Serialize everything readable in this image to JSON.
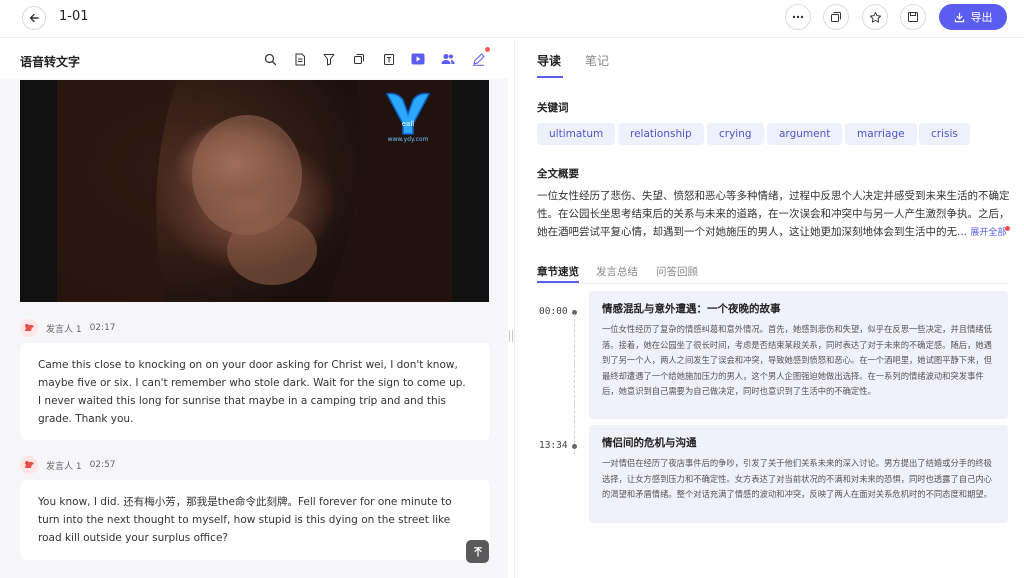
{
  "header": {
    "title": "1-01",
    "export_label": "导出",
    "icons": [
      "back-arrow-icon",
      "more-icon",
      "copy-icon",
      "star-icon",
      "save-icon",
      "download-icon"
    ]
  },
  "left": {
    "title": "语音转文字",
    "toolbar_icons": [
      "search-icon",
      "document-icon",
      "filter-icon",
      "copy-icon",
      "translate-icon",
      "play-icon",
      "speakers-icon",
      "edit-icon"
    ],
    "video": {
      "logo_text": "www.ydy.com"
    },
    "segments": [
      {
        "speaker": "发言人 1",
        "time": "02:17",
        "text": "Came this close to knocking on on your door asking for Christ wei, I don't know, maybe five or six. I can't remember who stole dark. Wait for the sign to come up. I never waited this long for sunrise that maybe in a camping trip and and this grade. Thank you."
      },
      {
        "speaker": "发言人 1",
        "time": "02:57",
        "text": "You know, I did. 还有梅小芳，那我是the命令此刻牌。Fell forever for one minute to turn into the next thought to myself, how stupid is this dying on the street like road kill outside your surplus office?"
      }
    ]
  },
  "right": {
    "tabs": [
      "导读",
      "笔记"
    ],
    "keywords_title": "关键词",
    "keywords": [
      "ultimatum",
      "relationship",
      "crying",
      "argument",
      "marriage",
      "crisis"
    ],
    "summary_title": "全文概要",
    "summary_text": "一位女性经历了悲伤、失望、愤怒和恶心等多种情绪，过程中反思个人决定并感受到未来生活的不确定性。在公园长坐思考结束后的关系与未来的道路，在一次误会和冲突中与另一人产生激烈争执。之后，她在酒吧尝试平复心情，却遇到一个对她施压的男人，这让她更加深刻地体会到生活中的无...",
    "expand_label": "展开全部",
    "subtabs": [
      "章节速览",
      "发言总结",
      "问答回顾"
    ],
    "chapters": [
      {
        "time": "00:00",
        "title": "情感混乱与意外遭遇：一个夜晚的故事",
        "body": "一位女性经历了复杂的情感纠葛和意外情况。首先，她感到悲伤和失望，似乎在反思一些决定，并且情绪低落。接着，她在公园坐了很长时间，考虑是否结束某段关系，同时表达了对于未来的不确定感。随后，她遇到了另一个人，两人之间发生了误会和冲突，导致她感到愤怒和恶心。在一个酒吧里，她试图平静下来，但最终却遭遇了一个给她施加压力的男人，这个男人企图强迫她做出选择。在一系列的情绪波动和突发事件后，她意识到自己需要为自己做决定，同时也意识到了生活中的不确定性。"
      },
      {
        "time": "13:34",
        "title": "情侣间的危机与沟通",
        "body": "一对情侣在经历了夜店事件后的争吵，引发了关于他们关系未来的深入讨论。男方提出了结婚或分手的终极选择，让女方感到压力和不确定性。女方表达了对当前状况的不满和对未来的恐惧，同时也透露了自己内心的渴望和矛盾情绪。整个对话充满了情感的波动和冲突，反映了两人在面对关系危机时的不同态度和期望。"
      }
    ]
  },
  "colors": {
    "accent": "#5b5cf0",
    "keyword_bg": "#eef1fc",
    "chapter_bg": "#f1f1fb",
    "notification": "#ff4d4f"
  }
}
